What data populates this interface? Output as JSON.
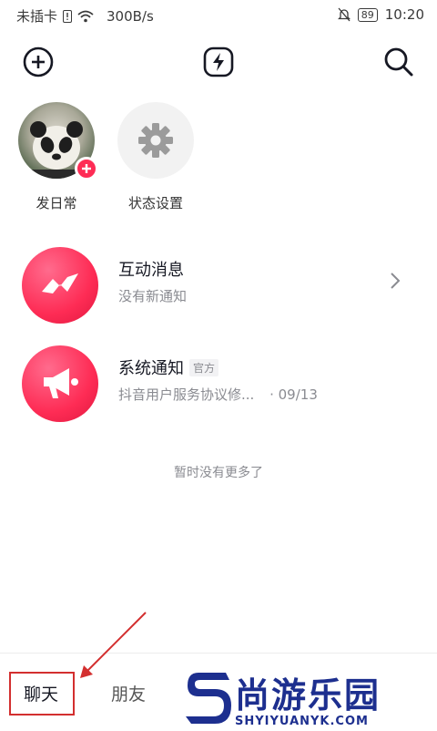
{
  "status_bar": {
    "carrier": "未插卡",
    "speed": "300B/s",
    "battery": "89",
    "time": "10:20"
  },
  "top_bar": {
    "icons": [
      "add-icon",
      "flash-icon",
      "search-icon"
    ]
  },
  "stories": [
    {
      "label": "发日常",
      "icon": "panda-avatar"
    },
    {
      "label": "状态设置",
      "icon": "gear-icon"
    }
  ],
  "messages": [
    {
      "title": "互动消息",
      "subtitle": "没有新通知",
      "icon": "lightning-chat-icon",
      "has_chevron": true
    },
    {
      "title": "系统通知",
      "badge": "官方",
      "subtitle": "抖音用户服务协议修...",
      "date": "· 09/13",
      "icon": "megaphone-icon"
    }
  ],
  "empty_note": "暂时没有更多了",
  "tabs": [
    {
      "label": "聊天",
      "active": true
    },
    {
      "label": "朋友",
      "active": false
    }
  ],
  "watermark": {
    "big": "尚游乐园",
    "small": "SHYIYUANYK.COM",
    "color": "#1d2f8f"
  },
  "colors": {
    "accent": "#fe2c55",
    "annotation": "#d32f2f"
  }
}
